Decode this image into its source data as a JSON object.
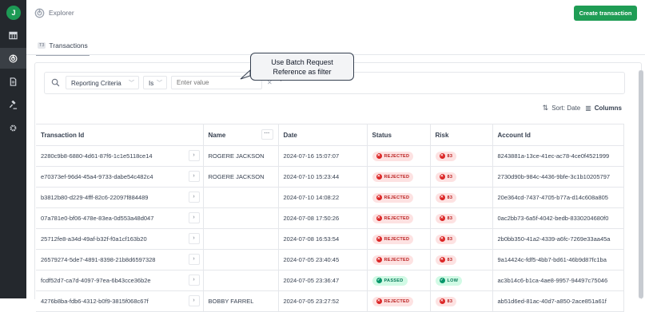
{
  "sidebar": {
    "logo": "J",
    "items": [
      {
        "icon": "table-icon"
      },
      {
        "icon": "explorer-icon",
        "active": true
      },
      {
        "icon": "document-icon"
      },
      {
        "icon": "gavel-icon"
      },
      {
        "icon": "gear-icon"
      }
    ]
  },
  "header": {
    "breadcrumb": "Explorer",
    "create_button": "Create transaction"
  },
  "tab": {
    "badge": "T3",
    "label": "Transactions"
  },
  "filter": {
    "field": "Reporting Criteria",
    "operator": "Is",
    "value_placeholder": "Enter value",
    "value": ""
  },
  "tooltip": {
    "line1": "Use Batch Request",
    "line2": "Reference as filter"
  },
  "toolbar": {
    "sort_label": "Sort: Date",
    "columns_label": "Columns"
  },
  "table": {
    "headers": {
      "transaction_id": "Transaction Id",
      "name": "Name",
      "date": "Date",
      "status": "Status",
      "risk": "Risk",
      "account_id": "Account Id"
    },
    "rows": [
      {
        "transaction_id": "2280c9b8-6880-4d61-87f6-1c1e5118ce14",
        "name": "ROGERE JACKSON",
        "date": "2024-07-16 15:07:07",
        "status": "REJECTED",
        "risk": "83",
        "account_id": "8243881a-13ce-41ec-ac78-4ce0f4521999"
      },
      {
        "transaction_id": "e70373ef-96d4-45a4-9733-dabe54c482c4",
        "name": "ROGERE JACKSON",
        "date": "2024-07-10 15:23:44",
        "status": "REJECTED",
        "risk": "83",
        "account_id": "2730d90b-984c-4436-9bfe-3c1b10205797"
      },
      {
        "transaction_id": "b3812b80-d229-4fff-82c6-22097f884489",
        "name": "",
        "date": "2024-07-10 14:08:22",
        "status": "REJECTED",
        "risk": "83",
        "account_id": "20e364cd-7437-4705-b77a-d14c608a805"
      },
      {
        "transaction_id": "07a781e0-bf06-478e-83ea-0d553a48d047",
        "name": "",
        "date": "2024-07-08 17:50:26",
        "status": "REJECTED",
        "risk": "83",
        "account_id": "0ac2bb73-6a5f-4042-bedb-8330204680f0"
      },
      {
        "transaction_id": "25712fe8-a34d-49af-b32f-f0a1cf163b20",
        "name": "",
        "date": "2024-07-08 16:53:54",
        "status": "REJECTED",
        "risk": "83",
        "account_id": "2b0bb350-41a2-4339-a6fc-7269e33aa45a"
      },
      {
        "transaction_id": "26579274-5de7-4891-8398-21b8d6597328",
        "name": "",
        "date": "2024-07-05 23:40:45",
        "status": "REJECTED",
        "risk": "83",
        "account_id": "9a14424c-fdf5-4bb7-bd61-46b9d87fc1ba"
      },
      {
        "transaction_id": "fcdf52d7-ca7d-4097-97ea-6b43cce36b2e",
        "name": "",
        "date": "2024-07-05 23:36:47",
        "status": "PASSED",
        "risk": "LOW",
        "account_id": "ac3b14c6-b1ca-4ae8-9957-94497c75046"
      },
      {
        "transaction_id": "4276b8ba-fdb6-4312-b0f9-3815f068c67f",
        "name": "BOBBY FARREL",
        "date": "2024-07-05 23:27:52",
        "status": "REJECTED",
        "risk": "83",
        "account_id": "ab51d6ed-81ac-40d7-a850-2ace851a61f"
      }
    ]
  },
  "colors": {
    "accent": "#1f9d55",
    "rejected": "#dc2626",
    "passed": "#059669",
    "sidebar": "#24282d"
  }
}
